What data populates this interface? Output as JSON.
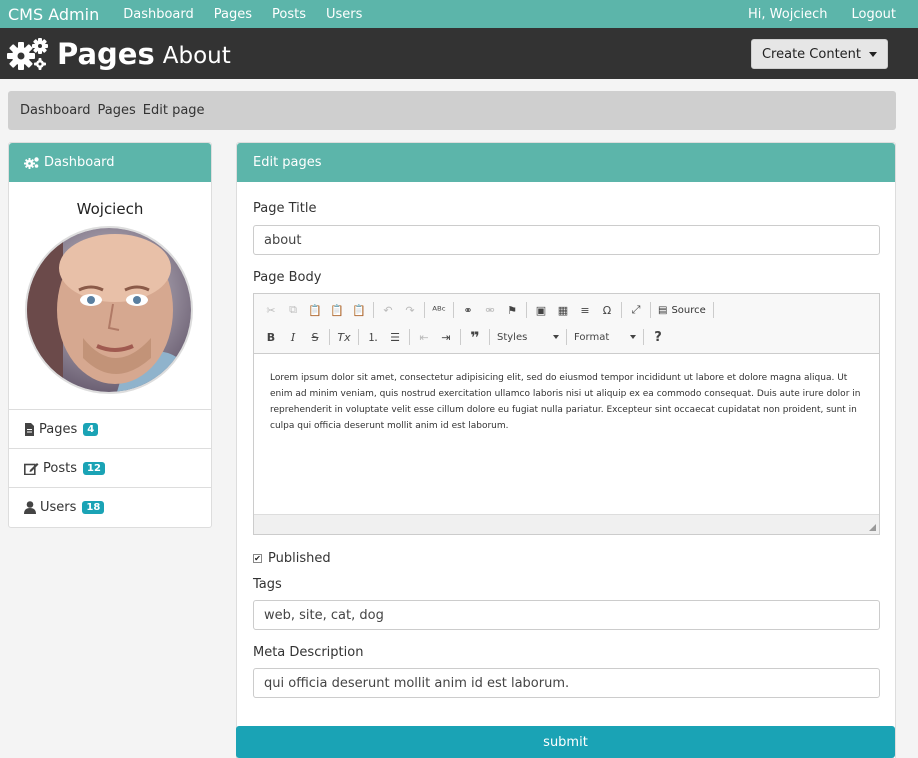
{
  "navbar": {
    "brand": "CMS Admin",
    "links": [
      "Dashboard",
      "Pages",
      "Posts",
      "Users"
    ],
    "greeting": "Hi, Wojciech",
    "logout": "Logout"
  },
  "header": {
    "title": "Pages",
    "subtitle": "About",
    "create_button": "Create Content"
  },
  "breadcrumb": [
    "Dashboard",
    "Pages",
    "Edit page"
  ],
  "sidebar": {
    "heading": "Dashboard",
    "user_name": "Wojciech",
    "items": [
      {
        "label": "Pages",
        "count": "4",
        "icon": "file-icon"
      },
      {
        "label": "Posts",
        "count": "12",
        "icon": "edit-icon"
      },
      {
        "label": "Users",
        "count": "18",
        "icon": "user-icon"
      }
    ]
  },
  "form": {
    "heading": "Edit pages",
    "title_label": "Page Title",
    "title_value": "about",
    "body_label": "Page Body",
    "body_text": "Lorem ipsum dolor sit amet, consectetur adipisicing elit, sed do eiusmod tempor incididunt ut labore et dolore magna aliqua. Ut enim ad minim veniam, quis nostrud exercitation ullamco laboris nisi ut aliquip ex ea commodo consequat. Duis aute irure dolor in reprehenderit in voluptate velit esse cillum dolore eu fugiat nulla pariatur. Excepteur sint occaecat cupidatat non proident, sunt in culpa qui officia deserunt mollit anim id est laborum.",
    "published_label": "Published",
    "published_checked": true,
    "tags_label": "Tags",
    "tags_value": "web, site, cat, dog",
    "meta_label": "Meta Description",
    "meta_value": "qui officia deserunt mollit anim id est laborum.",
    "submit_label": "submit"
  },
  "editor": {
    "source_label": "Source",
    "styles_label": "Styles",
    "format_label": "Format"
  },
  "colors": {
    "navbar": "#5cb5aa",
    "header": "#333333",
    "accent": "#1aa3b5"
  }
}
